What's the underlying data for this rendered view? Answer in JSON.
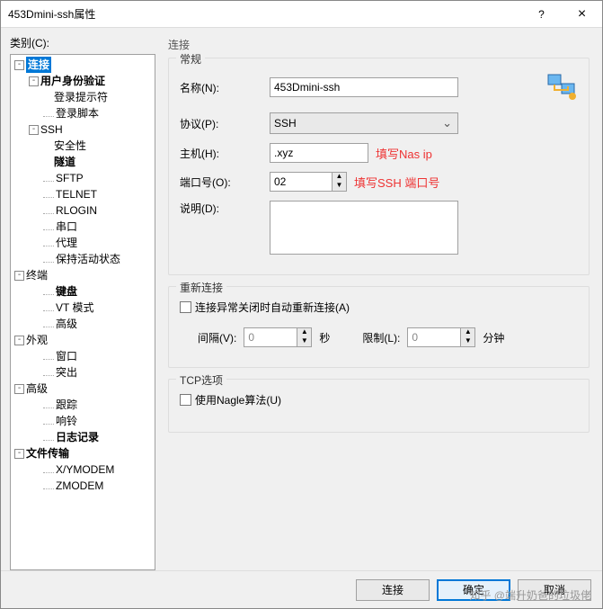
{
  "window": {
    "title": "453Dmini-ssh属性",
    "help": "?",
    "close": "×"
  },
  "category_label": "类别(C):",
  "tree": [
    {
      "pad": 4,
      "tw": "-",
      "text": "连接",
      "sel": true,
      "bold": true
    },
    {
      "pad": 20,
      "tw": "-",
      "text": "用户身份验证",
      "bold": true
    },
    {
      "pad": 48,
      "text": "登录提示符"
    },
    {
      "pad": 36,
      "dots": true,
      "text": "登录脚本"
    },
    {
      "pad": 20,
      "tw": "-",
      "text": "SSH"
    },
    {
      "pad": 48,
      "text": "安全性"
    },
    {
      "pad": 48,
      "text": "隧道",
      "bold": true
    },
    {
      "pad": 36,
      "dots": true,
      "text": "SFTP"
    },
    {
      "pad": 36,
      "dots": true,
      "text": "TELNET"
    },
    {
      "pad": 36,
      "dots": true,
      "text": "RLOGIN"
    },
    {
      "pad": 36,
      "dots": true,
      "text": "串口"
    },
    {
      "pad": 36,
      "dots": true,
      "text": "代理"
    },
    {
      "pad": 36,
      "dots": true,
      "text": "保持活动状态"
    },
    {
      "pad": 4,
      "tw": "-",
      "text": "终端"
    },
    {
      "pad": 36,
      "dots": true,
      "text": "键盘",
      "bold": true
    },
    {
      "pad": 36,
      "dots": true,
      "text": "VT 模式"
    },
    {
      "pad": 36,
      "dots": true,
      "text": "高级"
    },
    {
      "pad": 4,
      "tw": "-",
      "text": "外观"
    },
    {
      "pad": 36,
      "dots": true,
      "text": "窗口"
    },
    {
      "pad": 36,
      "dots": true,
      "text": "突出"
    },
    {
      "pad": 4,
      "tw": "-",
      "text": "高级"
    },
    {
      "pad": 36,
      "dots": true,
      "text": "跟踪"
    },
    {
      "pad": 36,
      "dots": true,
      "text": "响铃"
    },
    {
      "pad": 36,
      "dots": true,
      "text": "日志记录",
      "bold": true
    },
    {
      "pad": 4,
      "tw": "-",
      "text": "文件传输",
      "bold": true
    },
    {
      "pad": 36,
      "dots": true,
      "text": "X/YMODEM"
    },
    {
      "pad": 36,
      "dots": true,
      "text": "ZMODEM"
    }
  ],
  "panel_title": "连接",
  "general": {
    "legend": "常规",
    "name_label": "名称(N):",
    "name_value": "453Dmini-ssh",
    "proto_label": "协议(P):",
    "proto_value": "SSH",
    "host_label": "主机(H):",
    "host_value": ".xyz",
    "host_anno": "填写Nas ip",
    "port_label": "端口号(O):",
    "port_value": "02",
    "port_anno": "填写SSH 端口号",
    "desc_label": "说明(D):",
    "desc_value": ""
  },
  "reconnect": {
    "legend": "重新连接",
    "auto_label": "连接异常关闭时自动重新连接(A)",
    "interval_label": "间隔(V):",
    "interval_value": "0",
    "sec": "秒",
    "limit_label": "限制(L):",
    "limit_value": "0",
    "min": "分钟"
  },
  "tcp": {
    "legend": "TCP选项",
    "nagle_label": "使用Nagle算法(U)"
  },
  "footer": {
    "connect": "连接",
    "ok": "确定",
    "cancel": "取消"
  },
  "watermark": "知乎 @端升奶爸的垃圾佬"
}
